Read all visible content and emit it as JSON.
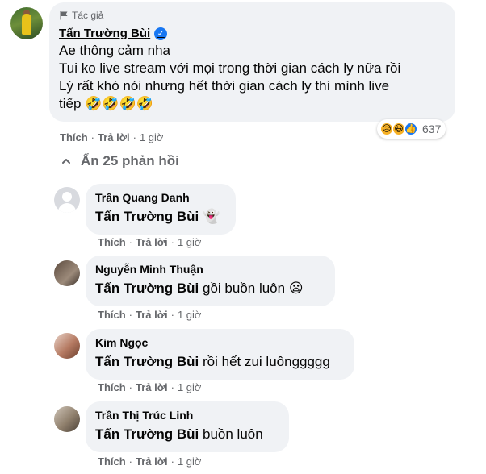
{
  "comment": {
    "badge": "Tác giả",
    "author": "Tấn Trường Bùi",
    "lines": [
      "Ae thông cảm nha",
      "Tui ko live stream với mọi trong thời gian cách ly nữa rồi",
      "Lý rất khó nói nhưng hết thời gian cách ly thì mình live",
      "tiếp 🤣🤣🤣🤣"
    ],
    "reaction_count": "637",
    "actions": {
      "like": "Thích",
      "reply": "Trả lời",
      "time": "1 giờ",
      "sep": "·"
    }
  },
  "hide_replies": "Ẩn 25 phản hồi",
  "replies": [
    {
      "name": "Trần Quang Danh",
      "mention": "Tấn Trường Bùi",
      "text": " 👻",
      "like": "Thích",
      "reply": "Trả lời",
      "time": "1 giờ"
    },
    {
      "name": "Nguyễn Minh Thuận",
      "mention": "Tấn Trường Bùi",
      "text": " gồi buồn luôn 😦",
      "like": "Thích",
      "reply": "Trả lời",
      "time": "1 giờ"
    },
    {
      "name": "Kim Ngọc",
      "mention": "Tấn Trường Bùi",
      "text": " rồi hết zui luônggggg",
      "like": "Thích",
      "reply": "Trả lời",
      "time": "1 giờ"
    },
    {
      "name": "Trần Thị Trúc Linh",
      "mention": "Tấn Trường Bùi",
      "text": " buồn luôn",
      "like": "Thích",
      "reply": "Trả lời",
      "time": "1 giờ"
    }
  ],
  "colors": {
    "bubble": "#f0f2f5",
    "meta": "#65676b",
    "verified": "#1877f2"
  }
}
